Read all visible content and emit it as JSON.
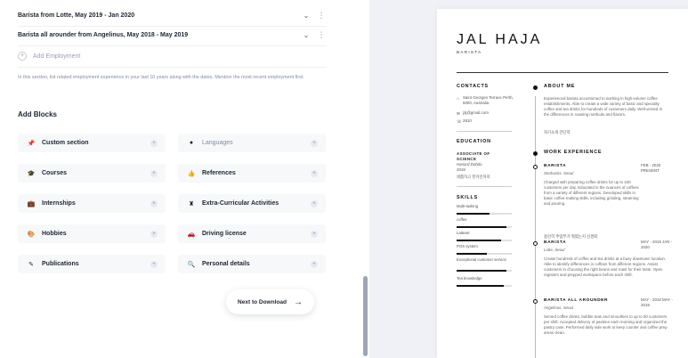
{
  "employment": {
    "items": [
      {
        "title": "Barista from Lotte, May 2019 - Jan 2020"
      },
      {
        "title": "Barista all arounder from Angelinus, May 2018 - May 2019"
      }
    ],
    "add_label": "Add Employment",
    "hint": "In this section, list related employment experience in your last 10 years along with the dates. Mention the most recent employment first."
  },
  "blocks": {
    "title": "Add Blocks",
    "items": [
      {
        "label": "Custom section",
        "icon": "pin-icon",
        "glyph": "📌"
      },
      {
        "label": "Languages",
        "icon": "globe-icon",
        "glyph": "●",
        "muted": true
      },
      {
        "label": "Courses",
        "icon": "graduation-cap-icon",
        "glyph": "🎓"
      },
      {
        "label": "References",
        "icon": "thumbs-up-icon",
        "glyph": "👍"
      },
      {
        "label": "Internships",
        "icon": "briefcase-icon",
        "glyph": "💼"
      },
      {
        "label": "Extra-Curricular Activities",
        "icon": "chess-icon",
        "glyph": "♜"
      },
      {
        "label": "Hobbies",
        "icon": "palette-icon",
        "glyph": "🎨"
      },
      {
        "label": "Driving license",
        "icon": "car-icon",
        "glyph": "🚗"
      },
      {
        "label": "Publications",
        "icon": "pen-icon",
        "glyph": "✎"
      },
      {
        "label": "Personal details",
        "icon": "magnifier-icon",
        "glyph": "🔍"
      }
    ],
    "plus": "+"
  },
  "next_button": {
    "label": "Next to Download",
    "arrow": "→"
  },
  "resume": {
    "name": "JAL HAJA",
    "role": "BARISTA",
    "contacts": {
      "title": "CONTACTS",
      "address": "Saint Georges Terrace Perth, 6000, Australia",
      "email": "j2j@gmail.com",
      "phone": "2810"
    },
    "education": {
      "title": "EDUCATION",
      "degree": "ASSOCIATE OF SCIENCE",
      "school": "Hanard Dohda",
      "year": "2018",
      "note": "외롭하고 한거인하지"
    },
    "skills": {
      "title": "SKILLS",
      "items": [
        {
          "name": "Multi-tasking",
          "level": 0.6
        },
        {
          "name": "coffee",
          "level": 0.9
        },
        {
          "name": "Latteart",
          "level": 0.8
        },
        {
          "name": "POS system",
          "level": 0.55
        },
        {
          "name": "Exceptional customer service",
          "level": 0.9
        },
        {
          "name": "Tea knowledge",
          "level": 0.85
        }
      ]
    },
    "about": {
      "title": "ABOUT ME",
      "text": "Experienced barista accustomed to working in high-volume coffee establishments. Able to create a wide variety of basic and specialty coffee and tea drinks for hundreds of customers daily. Well-versed in the differences in roasting methods and flavors.",
      "note": "자기소개 간단히"
    },
    "work": {
      "title": "WORK EXPERIENCE",
      "jobs": [
        {
          "title": "BARISTA",
          "place": "Starbucks, Seoul",
          "date": "FEB - 2020 PRESENT",
          "desc": "Charged with preparing coffee drinks for up to 100 customers per day. Educated in the nuances of coffees from a variety of different regions. Developed skills in basic coffee-making skills, including grinding, steaming and pouring.",
          "note": "용인히 주업무가 뭐였는지 신경회"
        },
        {
          "title": "BARISTA",
          "place": "Lotte, Seoul",
          "date": "MAY - 2019 JAN - 2020",
          "desc": "Create hundreds of coffee and tea drinks at a busy downtown location. Able to identify differences in coffees from different regions. Assist customers in choosing the right beans and roast for their taste. Open registers and prepped workspace before each shift."
        },
        {
          "title": "BARISTA ALL AROUNDER",
          "place": "Angelinus, Seoul",
          "date": "MAY - 2018 MAY - 2019",
          "desc": "Served coffee drinks, bubble teas and smoothies to up to 50 customers per shift. Accepted delivery of pastries each morning and organized the pastry case. Performed daily side work to keep counter and coffee prep areas clean."
        }
      ]
    }
  }
}
